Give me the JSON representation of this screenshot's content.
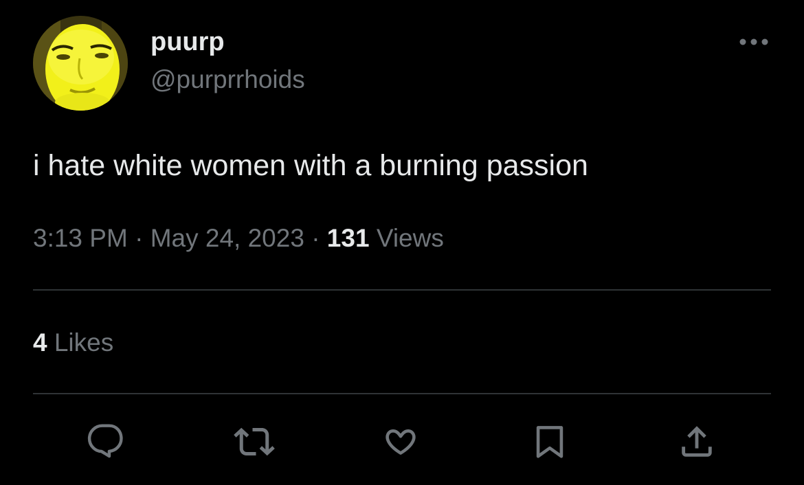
{
  "author": {
    "display_name": "puurp",
    "handle": "@purprrhoids",
    "avatar_accent": "#f2f01a"
  },
  "tweet": {
    "text": "i hate white women with a burning passion"
  },
  "meta": {
    "time": "3:13 PM",
    "date": "May 24, 2023",
    "separator": "·",
    "views_count": "131",
    "views_label": "Views"
  },
  "stats": {
    "likes_count": "4",
    "likes_label": "Likes"
  },
  "actions": [
    {
      "name": "reply",
      "icon": "reply-icon"
    },
    {
      "name": "retweet",
      "icon": "retweet-icon"
    },
    {
      "name": "like",
      "icon": "heart-icon"
    },
    {
      "name": "bookmark",
      "icon": "bookmark-icon"
    },
    {
      "name": "share",
      "icon": "share-icon"
    }
  ],
  "colors": {
    "background": "#000000",
    "primary_text": "#e7e9ea",
    "secondary_text": "#71767b",
    "divider": "#2f3336"
  }
}
